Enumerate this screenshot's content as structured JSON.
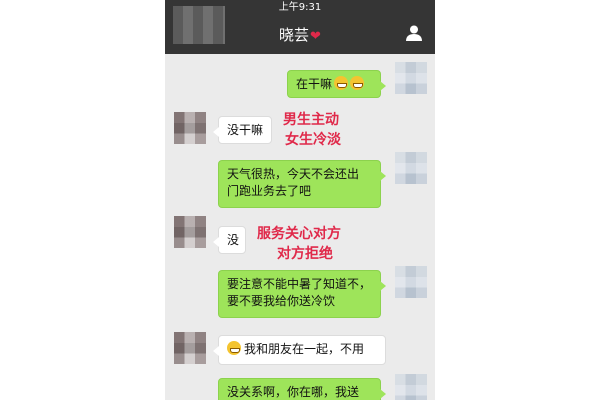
{
  "status": {
    "time": "上午9:31"
  },
  "nav": {
    "contact_name": "晓芸",
    "heart": "❤"
  },
  "icons": {
    "back_tag": "blurred-label",
    "profile": "person-icon",
    "emoji": "grinning-face-icon"
  },
  "colors": {
    "nav_bg": "#353535",
    "chat_bg": "#ebebeb",
    "my_bubble": "#9ee45a",
    "their_bubble": "#ffffff",
    "annotation": "#e0294a"
  },
  "messages": [
    {
      "from": "me",
      "text": "在干嘛",
      "emoji_count": 2
    },
    {
      "from": "them",
      "text": "没干嘛"
    },
    {
      "from": "me",
      "text_line1": "天气很热，今天不会还出",
      "text_line2": "门跑业务去了吧"
    },
    {
      "from": "them",
      "text": "没"
    },
    {
      "from": "me",
      "text_line1": "要注意不能中暑了知道不，",
      "text_line2": "要不要我给你送冷饮"
    },
    {
      "from": "them",
      "text": "我和朋友在一起，不用",
      "emoji_count": 1
    },
    {
      "from": "me",
      "text": "没关系啊，你在哪，我送"
    }
  ],
  "annotations": [
    {
      "line1": "男生主动",
      "line2": "女生冷淡"
    },
    {
      "line1": "服务关心对方",
      "line2": "对方拒绝"
    }
  ]
}
